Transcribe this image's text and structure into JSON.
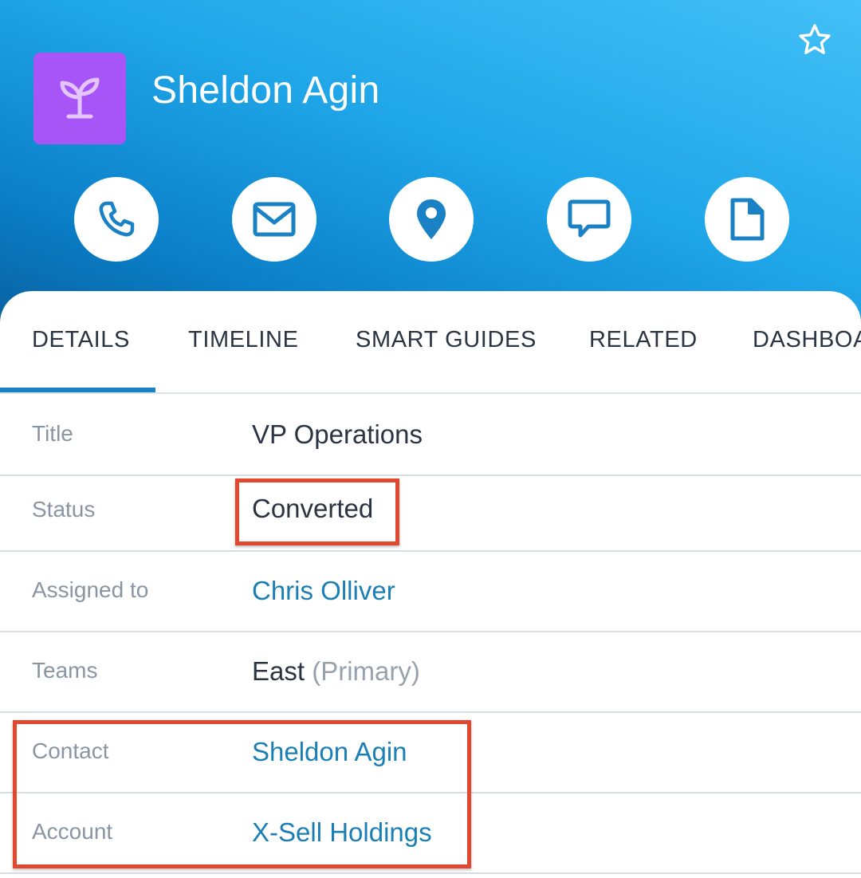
{
  "record": {
    "name": "Sheldon Agin",
    "avatar_color": "#a855f7",
    "avatar_icon": "sprout-icon"
  },
  "header": {
    "favorite_icon": "star-outline-icon",
    "actions": [
      {
        "icon": "phone-icon"
      },
      {
        "icon": "email-icon"
      },
      {
        "icon": "map-pin-icon"
      },
      {
        "icon": "message-icon"
      },
      {
        "icon": "document-icon"
      }
    ]
  },
  "tabs": [
    {
      "label": "DETAILS",
      "active": true
    },
    {
      "label": "TIMELINE",
      "active": false
    },
    {
      "label": "SMART GUIDES",
      "active": false
    },
    {
      "label": "RELATED",
      "active": false
    },
    {
      "label": "DASHBOARD",
      "active": false
    }
  ],
  "details": {
    "title": {
      "label": "Title",
      "value": "VP Operations"
    },
    "status": {
      "label": "Status",
      "value": "Converted"
    },
    "assigned": {
      "label": "Assigned to",
      "value": "Chris Olliver"
    },
    "teams": {
      "label": "Teams",
      "value": "East",
      "note": "(Primary)"
    },
    "contact": {
      "label": "Contact",
      "value": "Sheldon Agin"
    },
    "account": {
      "label": "Account",
      "value": "X-Sell Holdings"
    }
  },
  "colors": {
    "header_gradient": [
      "#43c0f7",
      "#075f9c"
    ],
    "accent": "#1a82c4",
    "link": "#1a7fb5",
    "highlight": "#e2472f"
  }
}
